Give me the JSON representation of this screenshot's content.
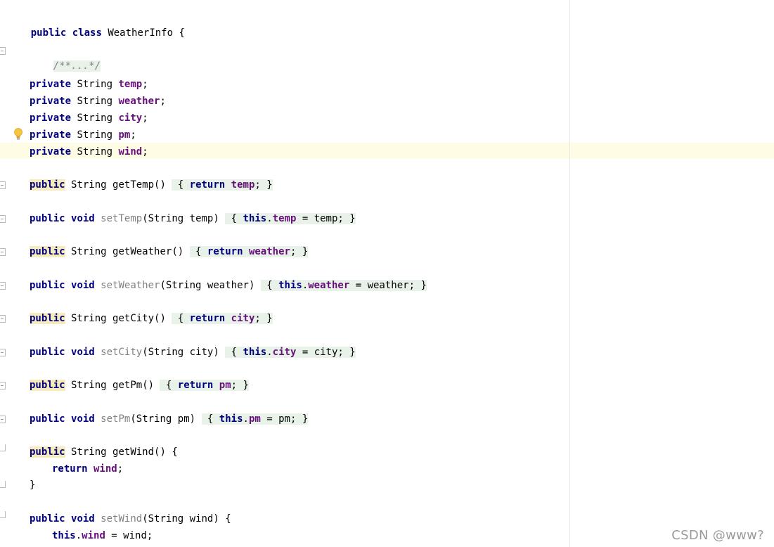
{
  "editor": {
    "file_language": "Java",
    "class_header": {
      "kw1": "public",
      "kw2": "class",
      "name": "WeatherInfo",
      "brace": "{"
    },
    "doc_comment_folded": "/**...*/",
    "fields": [
      {
        "kw": "private",
        "type": "String",
        "name": "temp"
      },
      {
        "kw": "private",
        "type": "String",
        "name": "weather"
      },
      {
        "kw": "private",
        "type": "String",
        "name": "city"
      },
      {
        "kw": "private",
        "type": "String",
        "name": "pm"
      },
      {
        "kw": "private",
        "type": "String",
        "name": "wind"
      }
    ],
    "getters": [
      {
        "kw": "public",
        "type": "String",
        "name": "getTemp",
        "field": "temp"
      },
      {
        "kw": "public",
        "type": "String",
        "name": "getWeather",
        "field": "weather"
      },
      {
        "kw": "public",
        "type": "String",
        "name": "getCity",
        "field": "city"
      },
      {
        "kw": "public",
        "type": "String",
        "name": "getPm",
        "field": "pm"
      }
    ],
    "setters": [
      {
        "kw": "public",
        "void": "void",
        "name": "setTemp",
        "param_type": "String",
        "param": "temp"
      },
      {
        "kw": "public",
        "void": "void",
        "name": "setWeather",
        "param_type": "String",
        "param": "weather"
      },
      {
        "kw": "public",
        "void": "void",
        "name": "setCity",
        "param_type": "String",
        "param": "city"
      },
      {
        "kw": "public",
        "void": "void",
        "name": "setPm",
        "param_type": "String",
        "param": "pm"
      }
    ],
    "expanded_getter": {
      "kw": "public",
      "type": "String",
      "name": "getWind",
      "return_kw": "return",
      "field": "wind"
    },
    "expanded_setter": {
      "kw": "public",
      "void": "void",
      "name": "setWind",
      "param_type": "String",
      "param": "wind",
      "this_kw": "this"
    },
    "keywords": {
      "return": "return",
      "this": "this"
    }
  },
  "watermark": "CSDN @www?",
  "colors": {
    "keyword": "#000080",
    "field": "#660e7a",
    "unused_method": "#808080",
    "current_line": "#fefce5",
    "fold_highlight": "#e9f2e9",
    "public_highlight": "#f6ebbc"
  },
  "icons": {
    "intention_bulb": "lightbulb-icon",
    "fold": "fold-marker-icon"
  }
}
